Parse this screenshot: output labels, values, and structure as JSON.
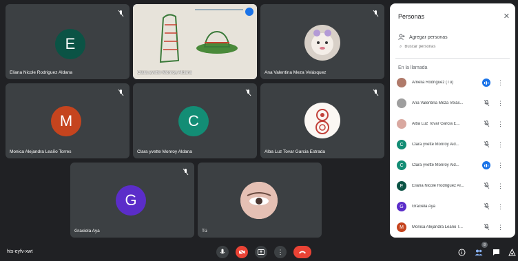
{
  "meeting": {
    "code": "hts-eyfv-xwt"
  },
  "tiles": {
    "t1": {
      "name": "Eliana Nicole Rodriguez Aldana",
      "initial": "E",
      "color": "#0b5345"
    },
    "t2": {
      "name": "Clara yvette Monroy Aldana"
    },
    "t3": {
      "name": "Ana Valentina Meza Velásquez"
    },
    "t4": {
      "name": "Monica Alejandra Leaño Torres",
      "initial": "M",
      "color": "#c5441e"
    },
    "t5": {
      "name": "Clara yvette Monroy Aldana",
      "initial": "C",
      "color": "#138d75"
    },
    "t6": {
      "name": "Alba Luz Tovar Garcia Estrada"
    },
    "t7": {
      "name": "Graciela Aya",
      "initial": "G",
      "color": "#5b2dc9"
    },
    "t8": {
      "name": "Tú"
    }
  },
  "panel": {
    "title": "Personas",
    "add_people": "Agregar personas",
    "search_placeholder": "Buscar personas",
    "section": "En la llamada",
    "participants": [
      {
        "name": "Amelia Rodriguez (Tú)",
        "initial": "",
        "color": "#b07a6a",
        "state": "speaking"
      },
      {
        "name": "Ana Valentina Meza Velás...",
        "initial": "",
        "color": "#9e9e9e",
        "state": "muted"
      },
      {
        "name": "Alba Luz Tovar Garcia E...",
        "initial": "",
        "color": "#d9a8a0",
        "state": "muted"
      },
      {
        "name": "Clara yvette Monroy Ald...",
        "initial": "C",
        "color": "#138d75",
        "state": "muted"
      },
      {
        "name": "Clara yvette Monroy Ald...",
        "initial": "C",
        "color": "#138d75",
        "state": "speaking"
      },
      {
        "name": "Eliana Nicole Rodriguez Al...",
        "initial": "E",
        "color": "#0b5345",
        "state": "muted"
      },
      {
        "name": "Graciela Aya",
        "initial": "G",
        "color": "#5b2dc9",
        "state": "muted"
      },
      {
        "name": "Monica Alejandra Leaño T...",
        "initial": "M",
        "color": "#c5441e",
        "state": "muted"
      }
    ]
  },
  "people_count": "8",
  "icons": {
    "mic": "mic-icon",
    "cam": "camera-off-icon",
    "present": "present-icon",
    "more": "more-icon",
    "end": "end-call-icon",
    "info": "info-icon",
    "people": "people-icon",
    "chat": "chat-icon",
    "activities": "activities-icon"
  },
  "colors": {
    "accent": "#1a73e8",
    "danger": "#ea4335",
    "tile": "#3c4043",
    "bg": "#202124"
  }
}
